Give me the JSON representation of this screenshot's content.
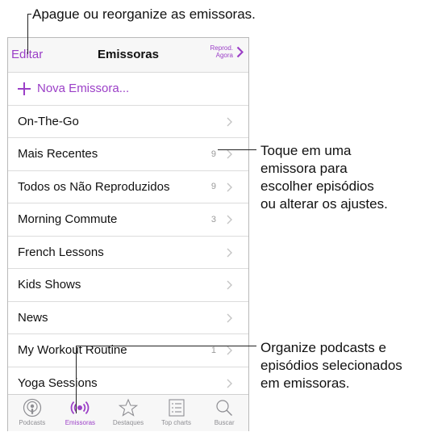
{
  "callouts": {
    "top": "Apague ou reorganize as emissoras.",
    "middle": [
      "Toque em uma",
      "emissora para",
      "escolher episódios",
      "ou alterar os ajustes."
    ],
    "bottom": [
      "Organize podcasts e",
      "episódios selecionados",
      "em emissoras."
    ]
  },
  "navbar": {
    "edit_label": "Editar",
    "title": "Emissoras",
    "play_line1": "Reprod.",
    "play_line2": "Agora"
  },
  "new_station": "Nova Emissora...",
  "stations": [
    {
      "label": "On-The-Go",
      "count": ""
    },
    {
      "label": "Mais Recentes",
      "count": "9"
    },
    {
      "label": "Todos os Não Reproduzidos",
      "count": "9"
    },
    {
      "label": "Morning Commute",
      "count": "3"
    },
    {
      "label": "French Lessons",
      "count": ""
    },
    {
      "label": "Kids Shows",
      "count": ""
    },
    {
      "label": "News",
      "count": ""
    },
    {
      "label": "My Workout Routine",
      "count": "1"
    },
    {
      "label": "Yoga Sessions",
      "count": ""
    }
  ],
  "tabs": [
    {
      "label": "Podcasts",
      "icon": "podcasts-icon"
    },
    {
      "label": "Emissoras",
      "icon": "stations-icon"
    },
    {
      "label": "Destaques",
      "icon": "star-icon"
    },
    {
      "label": "Top charts",
      "icon": "list-icon"
    },
    {
      "label": "Buscar",
      "icon": "search-icon"
    }
  ],
  "colors": {
    "accent": "#9b3fc7",
    "text": "#111111",
    "muted": "#9a9a9a"
  }
}
